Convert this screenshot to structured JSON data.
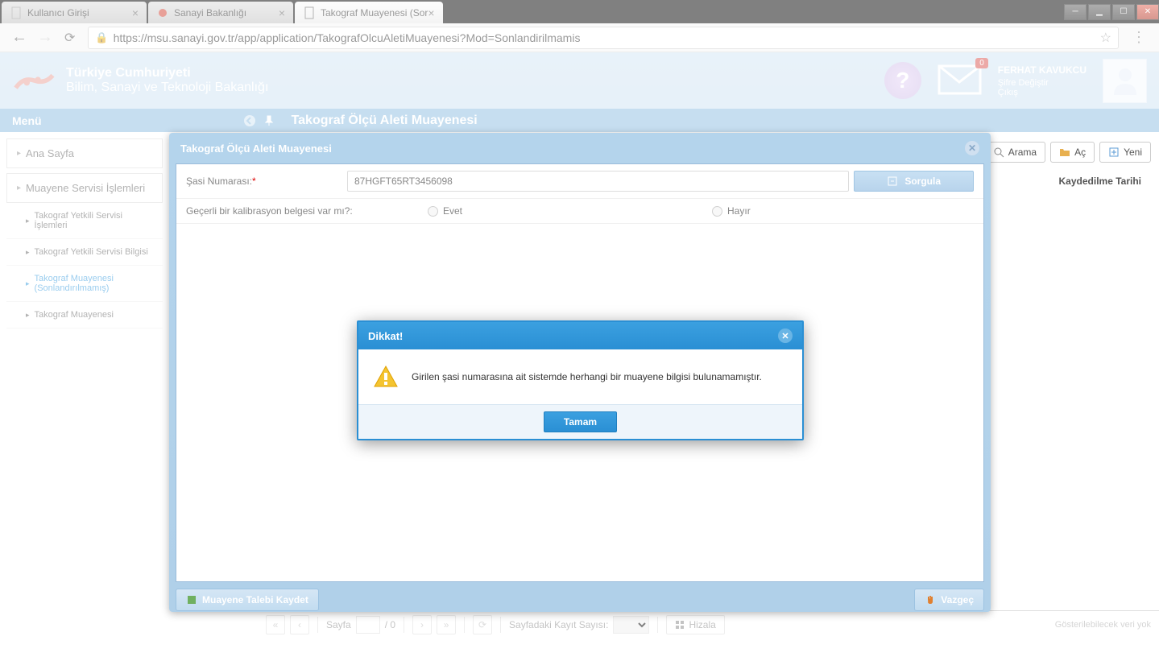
{
  "tabs": [
    {
      "title": "Kullanıcı Girişi"
    },
    {
      "title": "Sanayi Bakanlığı"
    },
    {
      "title": "Takograf Muayenesi (Sor"
    }
  ],
  "url": "https://msu.sanayi.gov.tr/app/application/TakografOlcuAletiMuayenesi?Mod=Sonlandirilmamis",
  "org": {
    "line1": "Türkiye Cumhuriyeti",
    "line2": "Bilim, Sanayi ve Teknoloji Bakanlığı"
  },
  "mail_badge": "0",
  "user": {
    "name": "FERHAT KAVUKCU",
    "change_pw": "Şifre Değiştir",
    "logout": "Çıkış"
  },
  "menu_label": "Menü",
  "page_title": "Takograf Ölçü Aleti Muayenesi",
  "sidebar": {
    "home": "Ana Sayfa",
    "group": "Muayene Servisi İşlemleri",
    "items": [
      "Takograf Yetkili Servisi İşlemleri",
      "Takograf Yetkili Servisi Bilgisi",
      "Takograf Muayenesi (Sonlandırılmamış)",
      "Takograf Muayenesi"
    ]
  },
  "toolbar": {
    "search": "Arama",
    "open": "Aç",
    "new": "Yeni"
  },
  "col_header": "Kaydedilme Tarihi",
  "panel": {
    "title": "Takograf Ölçü Aleti Muayenesi",
    "chassis_label": "Şasi Numarası:",
    "chassis_value": "87HGFT65RT3456098",
    "query": "Sorgula",
    "calib_label": "Geçerli bir kalibrasyon belgesi var mı?:",
    "yes": "Evet",
    "no": "Hayır",
    "save": "Muayene Talebi Kaydet",
    "cancel": "Vazgeç"
  },
  "alert": {
    "title": "Dikkat!",
    "message": "Girilen şasi numarasına ait sistemde herhangi bir muayene bilgisi bulunamamıştır.",
    "ok": "Tamam"
  },
  "pager": {
    "page_label": "Sayfa",
    "of": "/ 0",
    "count_label": "Sayfadaki Kayıt Sayısı:",
    "align": "Hizala",
    "empty": "Gösterilebilecek veri yok"
  }
}
